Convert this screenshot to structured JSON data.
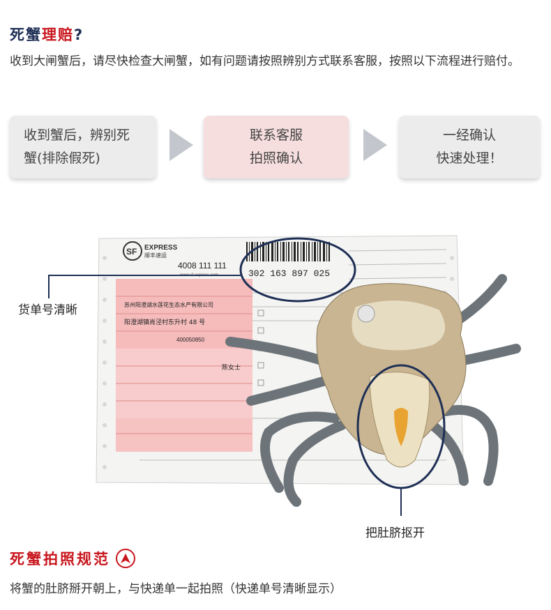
{
  "section1": {
    "title_part1": "死蟹",
    "title_part2": "理赔",
    "title_mark": "?",
    "intro": "收到大闸蟹后，请尽快检查大闸蟹，如有问题请按照辨别方式联系客服，按照以下流程进行赔付。"
  },
  "steps": [
    {
      "text": "收到蟹后，辨别死\n蟹(排除假死)"
    },
    {
      "text": "联系客服\n拍照确认"
    },
    {
      "text": "一经确认\n快速处理！"
    }
  ],
  "photo": {
    "waybill_number": "302 163 897 025",
    "waybill_brand": "EXPRESS",
    "waybill_brand_cn": "顺丰速运",
    "waybill_hotline": "4008 111 111",
    "waybill_website": "www.sf-express.com",
    "waybill_sender": "苏州阳澄湖水莲花生态水产有限公司",
    "waybill_address": "阳澄湖镇肖泾村东升村 48 号",
    "waybill_zip": "400050850",
    "waybill_receiver": "陈女士",
    "callout_left": "货单号清晰",
    "callout_bottom": "把肚脐抠开"
  },
  "section2": {
    "title": "死蟹拍照规范",
    "badge_letter": "A",
    "text": "将蟹的肚脐掰开朝上，与快递单一起拍照（快递单号清晰显示）"
  },
  "colors": {
    "navy": "#1e2f55",
    "red": "#c8161d",
    "pink": "#f7dede",
    "gray": "#ececec",
    "arrow": "#c3c6cc"
  }
}
